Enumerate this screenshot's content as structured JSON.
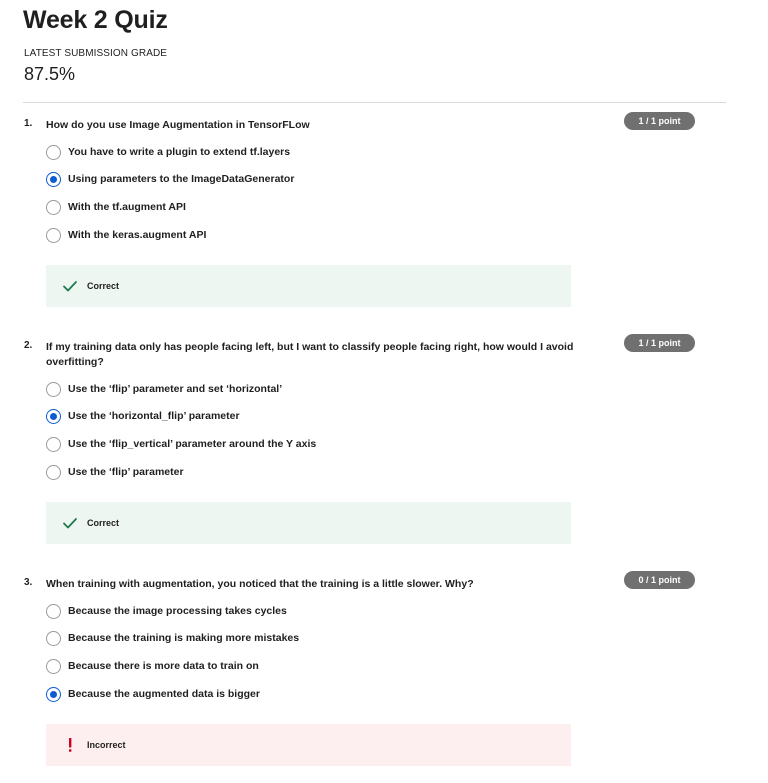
{
  "quiz": {
    "title": "Week 2 Quiz",
    "grade_label": "LATEST SUBMISSION GRADE",
    "grade_value": "87.5%"
  },
  "questions": [
    {
      "number": "1.",
      "text": "How do you use Image Augmentation in TensorFLow",
      "points": "1 / 1 point",
      "options": [
        {
          "label": "You have to write a plugin to extend tf.layers",
          "selected": false
        },
        {
          "label": "Using parameters to the ImageDataGenerator",
          "selected": true
        },
        {
          "label": "With the tf.augment API",
          "selected": false
        },
        {
          "label": "With the keras.augment API",
          "selected": false
        }
      ],
      "feedback": {
        "status": "correct",
        "text": "Correct"
      }
    },
    {
      "number": "2.",
      "text": "If my training data only has people facing left, but I want to classify people facing right, how would I avoid overfitting?",
      "points": "1 / 1 point",
      "options": [
        {
          "label": "Use the ‘flip’ parameter and set ‘horizontal’",
          "selected": false
        },
        {
          "label": "Use the ‘horizontal_flip’ parameter",
          "selected": true
        },
        {
          "label": "Use the ‘flip_vertical’ parameter around the Y axis",
          "selected": false
        },
        {
          "label": "Use the ‘flip’ parameter",
          "selected": false
        }
      ],
      "feedback": {
        "status": "correct",
        "text": "Correct"
      }
    },
    {
      "number": "3.",
      "text": "When training with augmentation, you noticed that the training is a little slower. Why?",
      "points": "0 / 1 point",
      "options": [
        {
          "label": "Because the image processing takes cycles",
          "selected": false
        },
        {
          "label": "Because the training is making more mistakes",
          "selected": false
        },
        {
          "label": "Because there is more data to train on",
          "selected": false
        },
        {
          "label": "Because the augmented data is bigger",
          "selected": true
        }
      ],
      "feedback": {
        "status": "incorrect",
        "text": "Incorrect"
      }
    }
  ],
  "colors": {
    "accent": "#0b5bd3",
    "correct_icon": "#1f7a4d",
    "incorrect_icon": "#d1001f",
    "badge": "#707070"
  },
  "icons": {
    "correct": "checkmark-icon",
    "incorrect": "exclamation-icon"
  }
}
